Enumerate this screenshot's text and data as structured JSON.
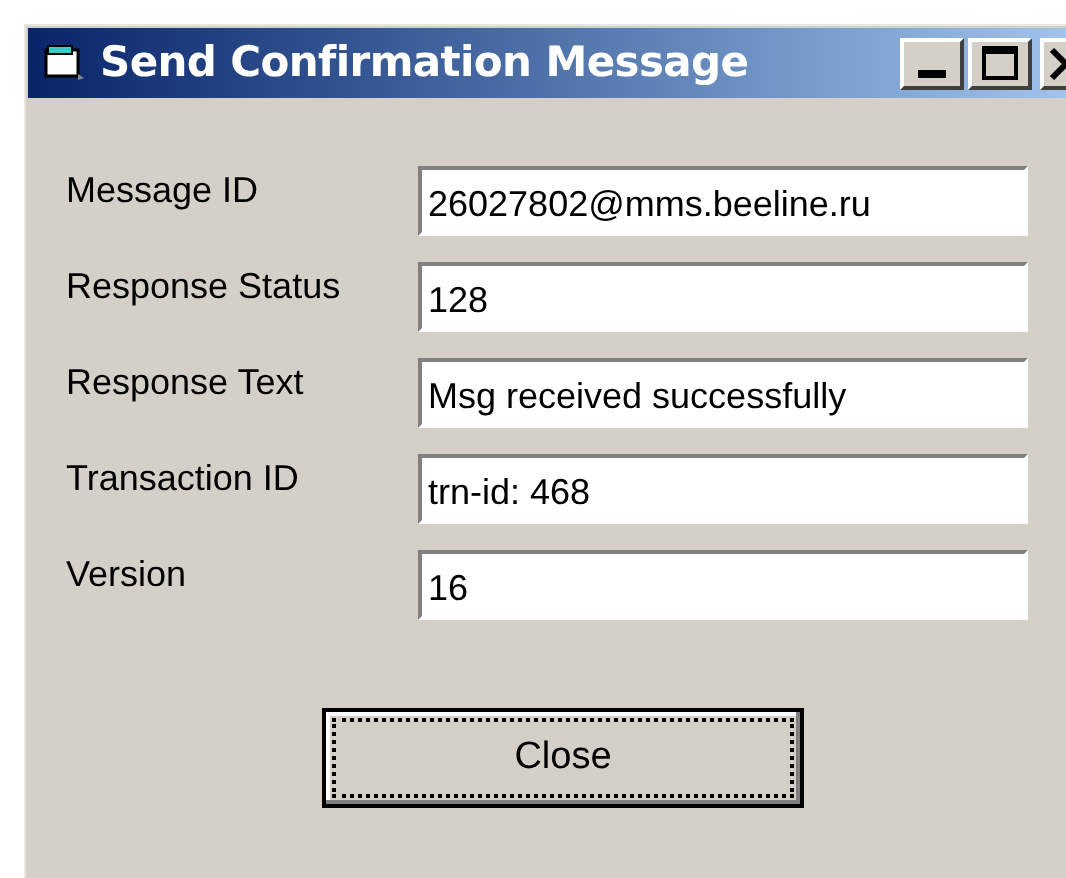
{
  "window": {
    "title": "Send Confirmation Message"
  },
  "fields": [
    {
      "label": "Message ID",
      "value": "26027802@mms.beeline.ru"
    },
    {
      "label": "Response Status",
      "value": "128"
    },
    {
      "label": "Response Text",
      "value": "Msg received successfully"
    },
    {
      "label": "Transaction ID",
      "value": "trn-id: 468"
    },
    {
      "label": "Version",
      "value": "16"
    }
  ],
  "buttons": [
    {
      "label": "Close",
      "focused": true
    }
  ]
}
